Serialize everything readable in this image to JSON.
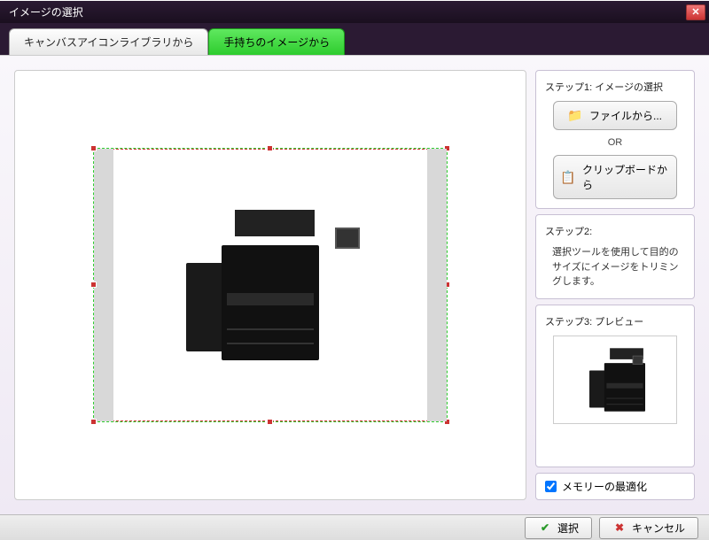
{
  "window": {
    "title": "イメージの選択"
  },
  "tabs": {
    "library": "キャンバスアイコンライブラリから",
    "own": "手持ちのイメージから"
  },
  "step1": {
    "label": "ステップ1: イメージの選択",
    "file_btn": "ファイルから...",
    "or": "OR",
    "clip_btn": "クリップボードから"
  },
  "step2": {
    "label": "ステップ2:",
    "desc": "選択ツールを使用して目的のサイズにイメージをトリミングします。"
  },
  "step3": {
    "label": "ステップ3: プレビュー"
  },
  "memory_opt": "メモリーの最適化",
  "footer": {
    "select": "選択",
    "cancel": "キャンセル"
  }
}
